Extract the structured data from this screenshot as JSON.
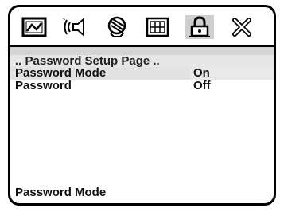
{
  "icons": [
    {
      "name": "display-icon"
    },
    {
      "name": "audio-icon"
    },
    {
      "name": "video-icon"
    },
    {
      "name": "grid-icon"
    },
    {
      "name": "lock-icon",
      "selected": true
    },
    {
      "name": "close-icon"
    }
  ],
  "page": {
    "title": ".. Password Setup Page .."
  },
  "rows": [
    {
      "label": "Password Mode",
      "value": "On"
    },
    {
      "label": "Password",
      "value": "Off"
    }
  ],
  "footer": {
    "help": "Password Mode"
  }
}
